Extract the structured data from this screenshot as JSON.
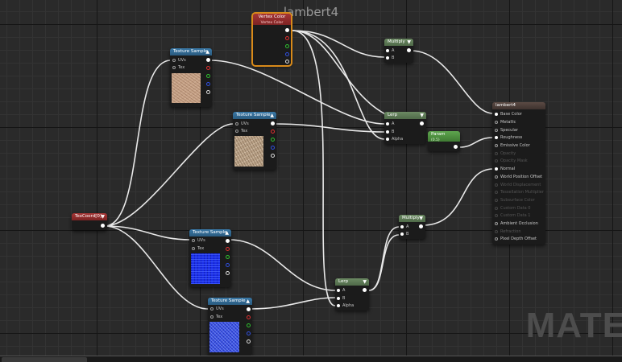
{
  "window": {
    "title": "lambert4",
    "watermark": "MATE"
  },
  "nodes": {
    "vertex_color": {
      "title": "Vertex Color",
      "subtitle": "Vertex Color"
    },
    "texcoord": {
      "title": "TexCoord[0]"
    },
    "tex1": {
      "title": "Texture Sample",
      "uvs": "UVs",
      "tex": "Tex"
    },
    "tex2": {
      "title": "Texture Sample",
      "uvs": "UVs",
      "tex": "Tex"
    },
    "tex3": {
      "title": "Texture Sample",
      "uvs": "UVs",
      "tex": "Tex"
    },
    "tex4": {
      "title": "Texture Sample",
      "uvs": "UVs",
      "tex": "Tex"
    },
    "multiply1": {
      "title": "Multiply",
      "a": "A",
      "b": "B"
    },
    "multiply2": {
      "title": "Multiply",
      "a": "A",
      "b": "B"
    },
    "lerp1": {
      "title": "Lerp",
      "a": "A",
      "b": "B",
      "alpha": "Alpha"
    },
    "lerp2": {
      "title": "Lerp",
      "a": "A",
      "b": "B",
      "alpha": "Alpha"
    },
    "param": {
      "title": "Param",
      "subtitle": "(0.5)"
    },
    "lambert": {
      "title": "lambert4",
      "inputs": [
        "Base Color",
        "Metallic",
        "Specular",
        "Roughness",
        "Emissive Color",
        "Opacity",
        "Opacity Mask",
        "Normal",
        "World Position Offset",
        "World Displacement",
        "Tessellation Multiplier",
        "Subsurface Color",
        "Custom Data 0",
        "Custom Data 1",
        "Ambient Occlusion",
        "Refraction",
        "Pixel Depth Offset"
      ]
    }
  },
  "colors": {
    "accent": "#d88a1a",
    "texture_header": "#3a79a8",
    "green_header": "#6c8a63"
  }
}
